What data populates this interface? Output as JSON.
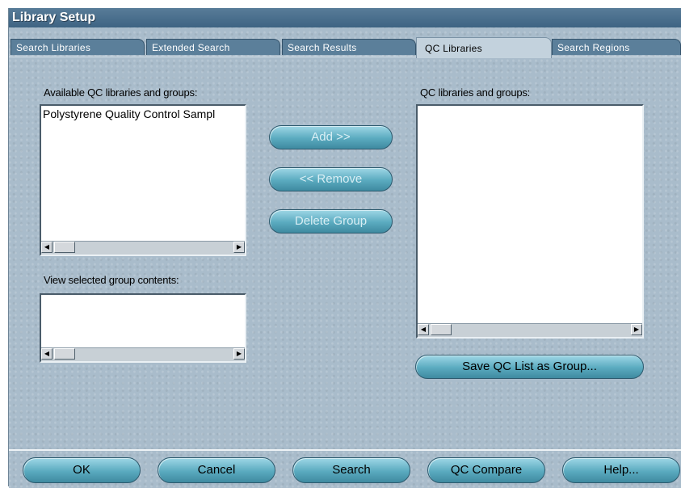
{
  "window": {
    "title": "Library Setup"
  },
  "tabs": [
    {
      "label": "Search Libraries",
      "active": false
    },
    {
      "label": "Extended Search",
      "active": false
    },
    {
      "label": "Search Results",
      "active": false
    },
    {
      "label": "QC Libraries",
      "active": true
    },
    {
      "label": "Search Regions",
      "active": false
    }
  ],
  "left": {
    "available_label": "Available QC libraries and groups:",
    "available_items": [
      "Polystyrene Quality Control Sampl"
    ],
    "group_contents_label": "View selected group contents:"
  },
  "middle": {
    "add_label": "Add >>",
    "remove_label": "<< Remove",
    "delete_group_label": "Delete Group"
  },
  "right": {
    "qc_label": "QC libraries and groups:",
    "save_group_label": "Save QC List as Group..."
  },
  "footer": {
    "ok_label": "OK",
    "cancel_label": "Cancel",
    "search_label": "Search",
    "qc_compare_label": "QC Compare",
    "help_label": "Help..."
  },
  "icons": {
    "scroll_left": "left-arrow-icon",
    "scroll_right": "right-arrow-icon"
  },
  "colors": {
    "titlebar": "#4a6f8c",
    "panel": "#a9bccb",
    "button": "#5aaabf"
  }
}
